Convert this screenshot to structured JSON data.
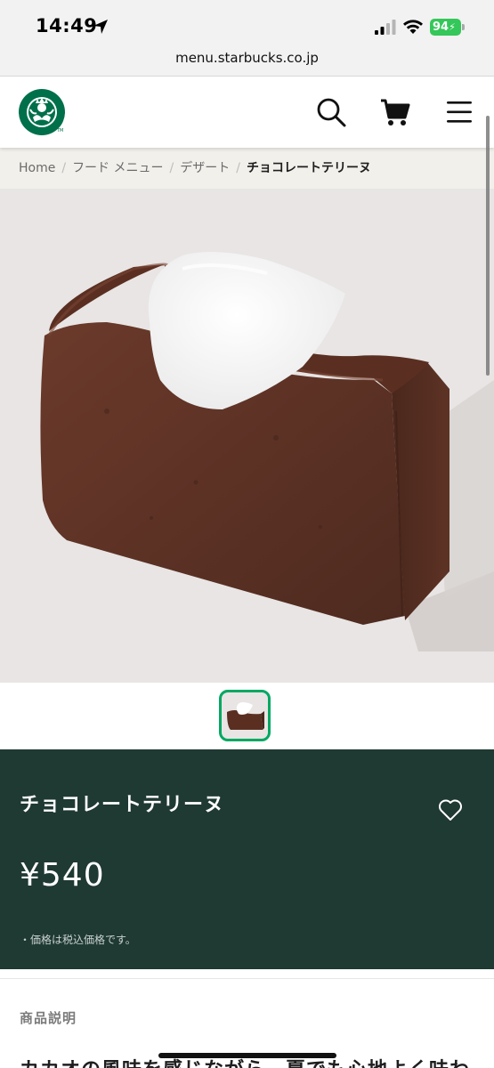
{
  "status_bar": {
    "time": "14:49",
    "battery": "94"
  },
  "browser": {
    "url": "menu.starbucks.co.jp"
  },
  "header": {
    "logo_icon": "starbucks-siren-logo",
    "search_icon": "search-icon",
    "cart_icon": "cart-icon",
    "menu_icon": "hamburger-menu-icon"
  },
  "breadcrumb": {
    "items": [
      "Home",
      "フード メニュー",
      "デザート"
    ],
    "separator": "/",
    "current": "チョコレートテリーヌ"
  },
  "product": {
    "name": "チョコレートテリーヌ",
    "price": "¥540",
    "tax_note": "・価格は税込価格です。",
    "favorite_icon": "heart-outline-icon"
  },
  "description": {
    "heading": "商品説明",
    "text": "カカオの風味を感じながら、夏でも心地よく味わ"
  },
  "colors": {
    "brand_green": "#00704a",
    "panel_green": "#1f3933",
    "accent_green": "#00a862",
    "battery_green": "#34c759"
  }
}
